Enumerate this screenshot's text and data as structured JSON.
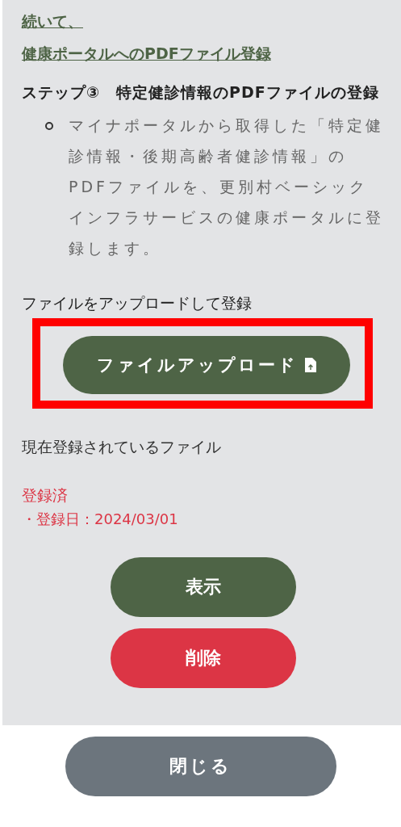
{
  "link_lines": [
    "続いて、",
    "健康ポータルへのPDFファイル登録"
  ],
  "step_title": "ステップ③　特定健診情報のPDFファイルの登録",
  "bullets": [
    "マイナポータルから取得した「特定健診情報・後期高齢者健診情報」のPDFファイルを、更別村ベーシックインフラサービスの健康ポータルに登録します。"
  ],
  "upload": {
    "label": "ファイルをアップロードして登録",
    "button": "ファイルアップロード",
    "highlighted": true
  },
  "current": {
    "heading": "現在登録されているファイル",
    "status": "登録済",
    "date": "・登録日：2024/03/01"
  },
  "actions": [
    {
      "kind": "view",
      "label": "表示"
    },
    {
      "kind": "delete",
      "label": "削除"
    }
  ],
  "close": "閉じる"
}
